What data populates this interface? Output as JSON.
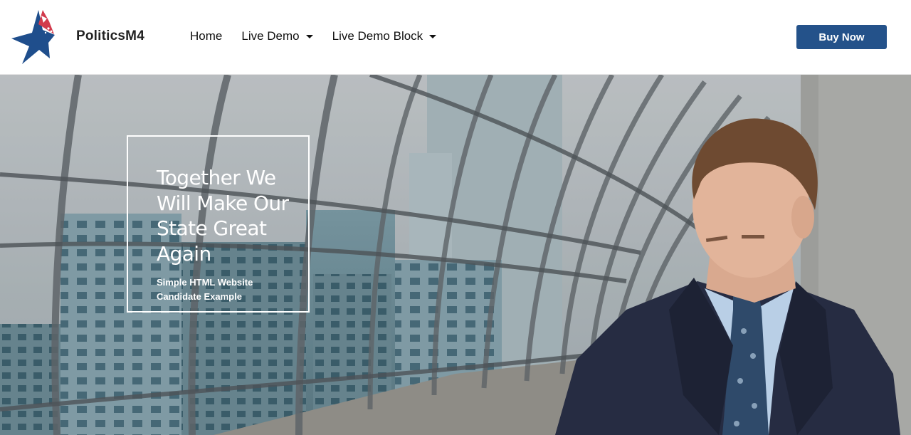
{
  "header": {
    "brand": "PoliticsM4",
    "logo_icon": "star-flag-logo-icon",
    "nav": [
      {
        "label": "Home",
        "has_dropdown": false
      },
      {
        "label": "Live Demo",
        "has_dropdown": true
      },
      {
        "label": "Live Demo Block",
        "has_dropdown": true
      }
    ],
    "buy_button": "Buy Now"
  },
  "hero": {
    "title": "Together We Will Make Our State Great Again",
    "subtitle": "Simple HTML Website Candidate Example",
    "image": "businessman-on-rooftop-photo"
  },
  "colors": {
    "accent": "#24528a",
    "logo_navy": "#1f4e8c",
    "logo_red": "#d23a4c",
    "nav_text": "#111111",
    "hero_text": "#ffffff"
  }
}
